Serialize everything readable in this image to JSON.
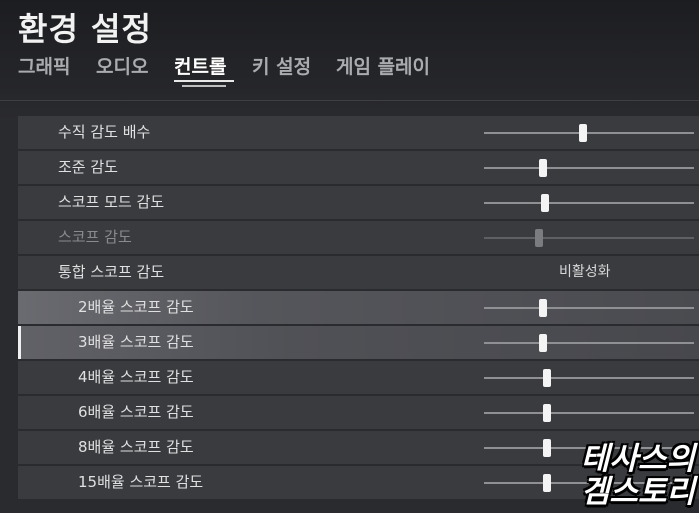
{
  "page": {
    "title": "환경 설정"
  },
  "tabs": [
    {
      "label": "그래픽",
      "active": false
    },
    {
      "label": "오디오",
      "active": false
    },
    {
      "label": "컨트롤",
      "active": true
    },
    {
      "label": "키 설정",
      "active": false
    },
    {
      "label": "게임 플레이",
      "active": false
    }
  ],
  "settings": [
    {
      "label": "수직 감도 배수",
      "type": "slider",
      "value": 0.47,
      "disabled": false
    },
    {
      "label": "조준 감도",
      "type": "slider",
      "value": 0.28,
      "disabled": false
    },
    {
      "label": "스코프 모드 감도",
      "type": "slider",
      "value": 0.29,
      "disabled": false
    },
    {
      "label": "스코프 감도",
      "type": "slider",
      "value": 0.26,
      "disabled": true
    },
    {
      "label": "통합 스코프 감도",
      "type": "text",
      "value_text": "비활성화",
      "disabled": false
    },
    {
      "label": "2배율 스코프 감도",
      "type": "slider",
      "value": 0.28,
      "disabled": false
    },
    {
      "label": "3배율 스코프 감도",
      "type": "slider",
      "value": 0.28,
      "disabled": false
    },
    {
      "label": "4배율 스코프 감도",
      "type": "slider",
      "value": 0.3,
      "disabled": false
    },
    {
      "label": "6배율 스코프 감도",
      "type": "slider",
      "value": 0.3,
      "disabled": false
    },
    {
      "label": "8배율 스코프 감도",
      "type": "slider",
      "value": 0.3,
      "disabled": false
    },
    {
      "label": "15배율 스코프 감도",
      "type": "slider",
      "value": 0.3,
      "disabled": false
    }
  ],
  "watermark": {
    "line1": "테사스의",
    "line2": "겜스토리"
  },
  "colors": {
    "background": "#2a2b2e",
    "row": "#3a3b3f",
    "accent": "#f4f4f4"
  }
}
